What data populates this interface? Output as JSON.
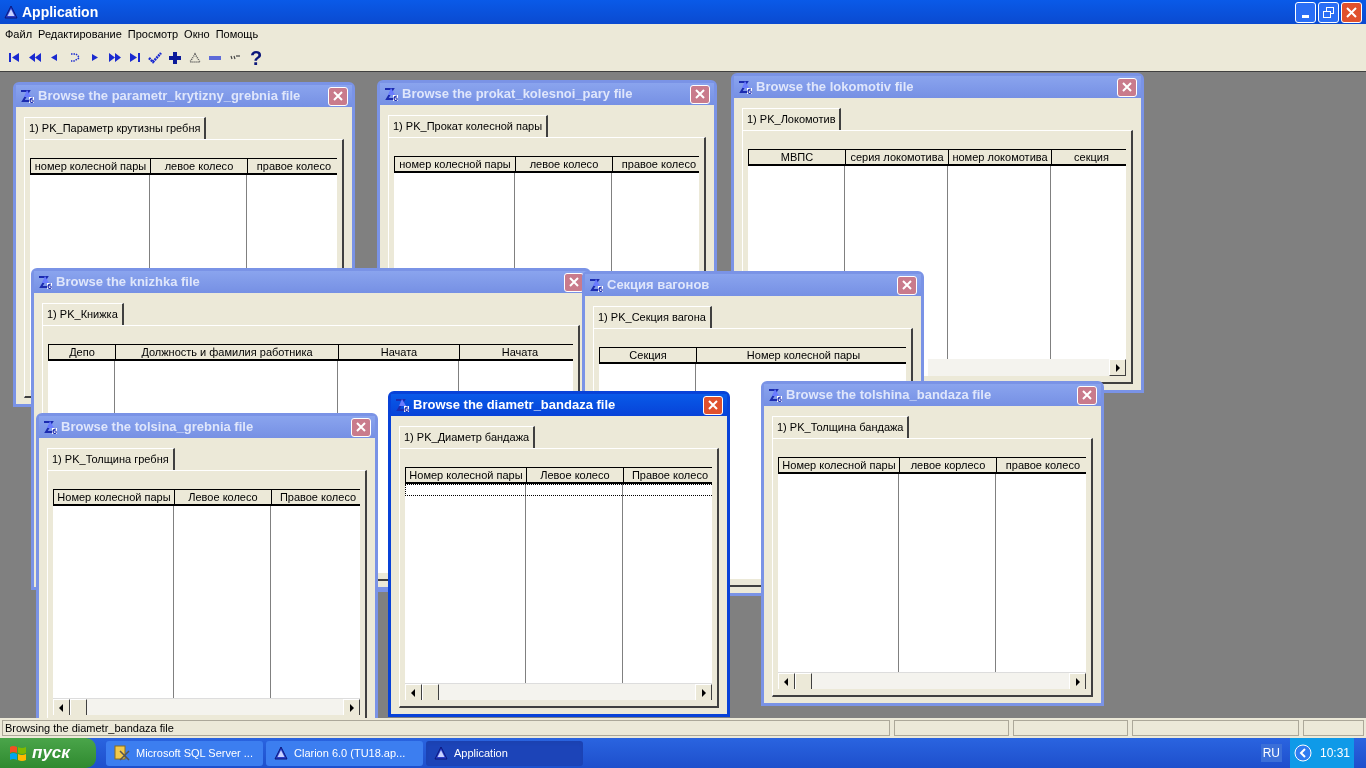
{
  "window": {
    "title": "Application"
  },
  "menu": [
    "Файл",
    "Редактирование",
    "Просмотр",
    "Окно",
    "Помощь"
  ],
  "toolbar": [
    {
      "kind": "first"
    },
    {
      "kind": "fastback"
    },
    {
      "kind": "back"
    },
    {
      "kind": "swap"
    },
    {
      "kind": "forward"
    },
    {
      "kind": "fastforward"
    },
    {
      "kind": "last"
    },
    {
      "kind": "check"
    },
    {
      "kind": "plus"
    },
    {
      "kind": "triangle"
    },
    {
      "kind": "dash"
    },
    {
      "kind": "quotes"
    },
    {
      "kind": "help",
      "label": "?"
    }
  ],
  "mdi_windows": [
    {
      "title": "Browse the parametr_krytizny_grebnia file",
      "active": false,
      "tab": {
        "label": "1) PK_Параметр крутизны гребня",
        "selected": true
      },
      "columns": [
        "номер колесной пары",
        "левое колесо",
        "правое колесо"
      ]
    },
    {
      "title": "Browse the prokat_kolesnoi_pary file",
      "active": false,
      "tab": {
        "label": "1) PK_Прокат колесной пары",
        "selected": true
      },
      "columns": [
        "номер колесной пары",
        "левое колесо",
        "правое колесо"
      ]
    },
    {
      "title": "Browse the lokomotiv file",
      "active": false,
      "tab": {
        "label": "1) PK_Локомотив",
        "selected": true
      },
      "columns": [
        "МВПС",
        "серия локомотива",
        "номер локомотива",
        "секция"
      ]
    },
    {
      "title": "Browse the knizhka file",
      "active": false,
      "tab": {
        "label": "1) PK_Книжка",
        "selected": true
      },
      "columns": [
        "Депо",
        "Должность и фамилия работника",
        "Начата",
        "Начата"
      ]
    },
    {
      "title": "Секция вагонов",
      "active": false,
      "tab": {
        "label": "1) PK_Секция вагона",
        "selected": true
      },
      "columns": [
        "Секция",
        "Номер колесной пары"
      ]
    },
    {
      "title": "Browse the tolsina_grebnia file",
      "active": false,
      "tab": {
        "label": "1) PK_Толщина гребня",
        "selected": true
      },
      "columns": [
        "Номер колесной пары",
        "Левое колесо",
        "Правое колесо"
      ]
    },
    {
      "title": "Browse the tolshina_bandaza file",
      "active": false,
      "tab": {
        "label": "1) PK_Толщина бандажа",
        "selected": true
      },
      "columns": [
        "Номер колесной пары",
        "левое корлесо",
        "правое колесо"
      ]
    },
    {
      "title": "Browse the diametr_bandaza file",
      "active": true,
      "tab": {
        "label": "1) PK_Диаметр бандажа",
        "selected": true
      },
      "columns": [
        "Номер колесной пары",
        "Левое колесо",
        "Правое колесо"
      ]
    }
  ],
  "status_bar": {
    "text": "Browsing the diametr_bandaza file"
  },
  "taskbar": {
    "start": "пуск",
    "tasks": [
      {
        "label": "Microsoft SQL Server ...",
        "kind": "sql",
        "selected": false
      },
      {
        "label": "Clarion 6.0 (TU18.ap...",
        "kind": "clarion",
        "selected": false
      },
      {
        "label": "Application",
        "kind": "clarion",
        "selected": true
      }
    ],
    "language": "RU",
    "clock": "10:31"
  }
}
